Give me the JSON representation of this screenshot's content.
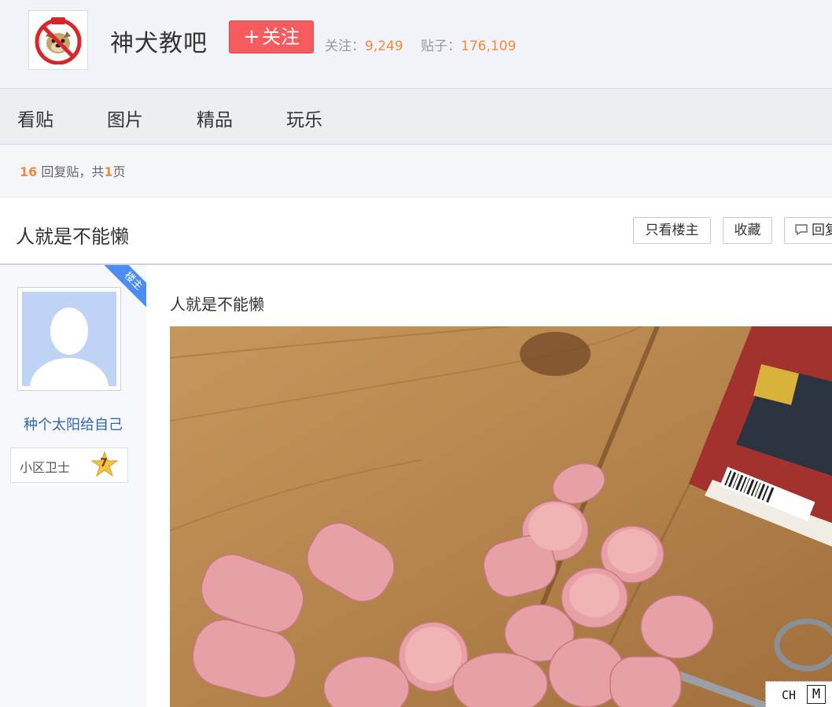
{
  "header": {
    "bar_name": "神犬教吧",
    "follow_label": "关注",
    "follow_plus": "+",
    "followers_label": "关注：",
    "followers_count": "9,249",
    "posts_label": "贴子：",
    "posts_count": "176,109",
    "logo_icon": "no-bulldog-logo-icon"
  },
  "nav": {
    "items": [
      {
        "label": "看贴"
      },
      {
        "label": "图片"
      },
      {
        "label": "精品"
      },
      {
        "label": "玩乐"
      }
    ]
  },
  "replies": {
    "count": "16",
    "reply_text": " 回复贴，共",
    "pages": "1",
    "page_suffix": "页"
  },
  "thread": {
    "title": "人就是不能懒",
    "only_op_label": "只看楼主",
    "favorite_label": "收藏",
    "reply_label": "回复"
  },
  "author": {
    "op_tag": "楼主",
    "username": "种个太阳给自己",
    "badge_label": "小区卫士",
    "level": "7"
  },
  "post": {
    "text": "人就是不能懒"
  },
  "ime": {
    "mode": "CH",
    "indicator": "M"
  },
  "colors": {
    "follow_button": "#f45c60",
    "highlight_number": "#f08a3c",
    "username_link": "#2d64b3",
    "op_ribbon": "#4c8cf5"
  }
}
